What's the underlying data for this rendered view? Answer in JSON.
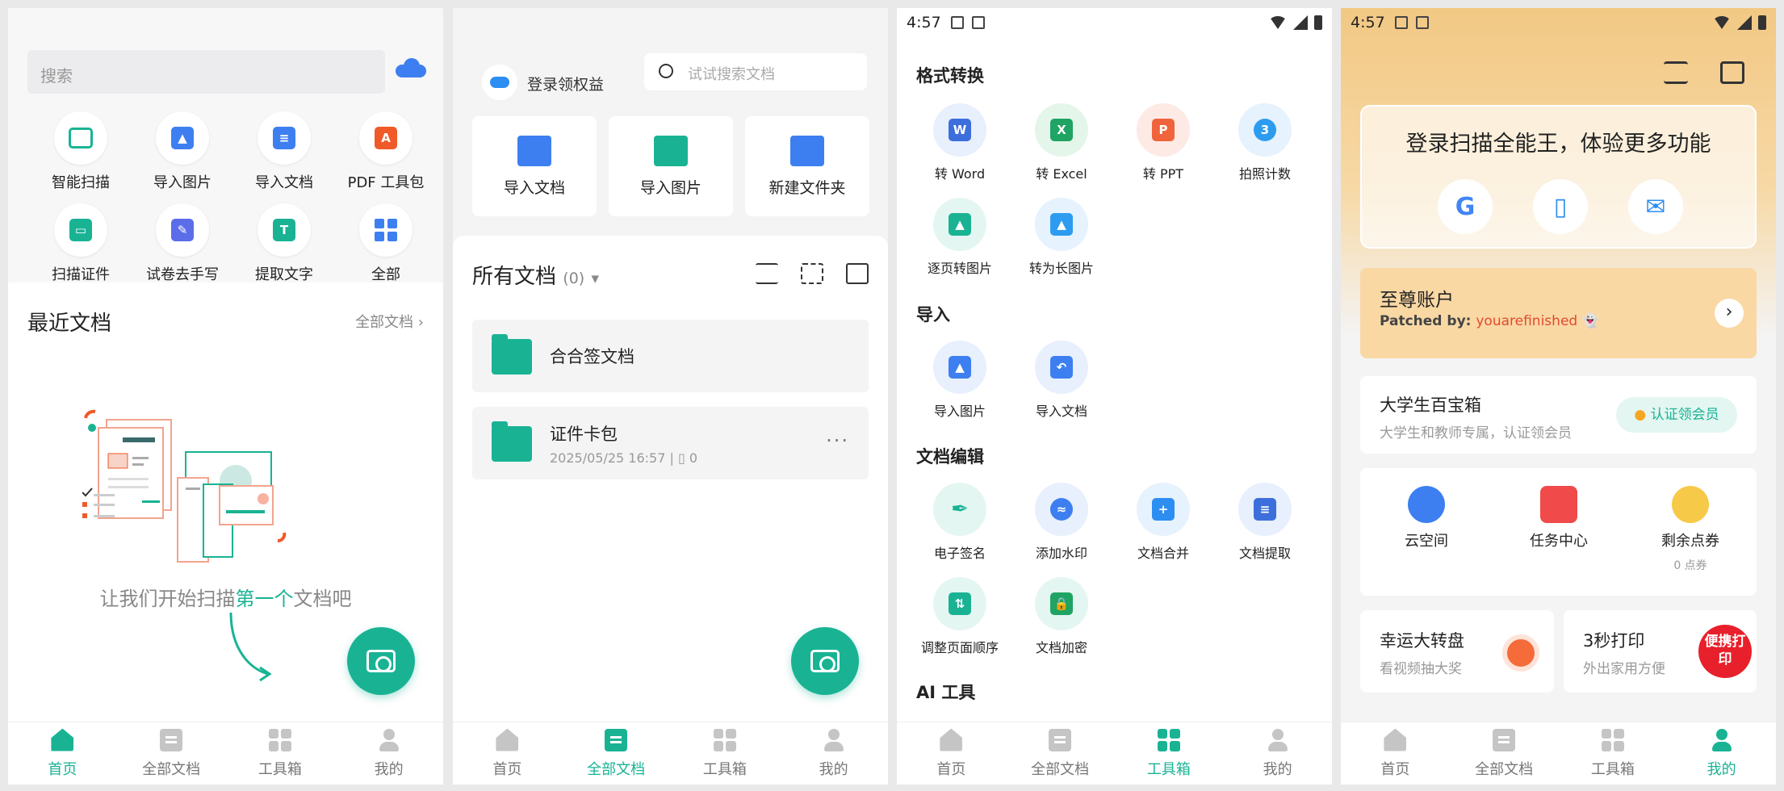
{
  "colors": {
    "accent": "#19b394",
    "vip_bg": "#f9d8a4"
  },
  "status": {
    "time": "4:57"
  },
  "nav": {
    "home": "首页",
    "all_docs": "全部文档",
    "toolbox": "工具箱",
    "me": "我的"
  },
  "home": {
    "search_placeholder": "搜索",
    "tools": [
      {
        "label": "智能扫描",
        "icon": "smart-scan-icon"
      },
      {
        "label": "导入图片",
        "icon": "import-image-icon"
      },
      {
        "label": "导入文档",
        "icon": "import-doc-icon"
      },
      {
        "label": "PDF 工具包",
        "icon": "pdf-toolkit-icon"
      },
      {
        "label": "扫描证件",
        "icon": "id-scan-icon"
      },
      {
        "label": "试卷去手写",
        "icon": "remove-handwriting-icon"
      },
      {
        "label": "提取文字",
        "icon": "extract-text-icon"
      },
      {
        "label": "全部",
        "icon": "all-tools-icon"
      }
    ],
    "recent_title": "最近文档",
    "recent_all": "全部文档",
    "empty_prefix": "让我们开始扫描",
    "empty_highlight": "第一个",
    "empty_suffix": "文档吧"
  },
  "docs": {
    "login_text": "登录领权益",
    "search_placeholder": "试试搜索文档",
    "quick": [
      {
        "label": "导入文档",
        "icon": "import-doc-icon"
      },
      {
        "label": "导入图片",
        "icon": "import-image-icon"
      },
      {
        "label": "新建文件夹",
        "icon": "new-folder-icon"
      }
    ],
    "title": "所有文档",
    "count": "(0)",
    "folders": [
      {
        "name": "合合签文档"
      },
      {
        "name": "证件卡包",
        "date": "2025/05/25 16:57",
        "files": "0"
      }
    ]
  },
  "toolbox": {
    "format_title": "格式转换",
    "format_tools": [
      {
        "label": "转 Word",
        "icon": "word-icon"
      },
      {
        "label": "转 Excel",
        "icon": "excel-icon"
      },
      {
        "label": "转 PPT",
        "icon": "ppt-icon"
      },
      {
        "label": "拍照计数",
        "icon": "photo-count-icon"
      },
      {
        "label": "逐页转图片",
        "icon": "page-to-image-icon"
      },
      {
        "label": "转为长图片",
        "icon": "long-image-icon"
      }
    ],
    "import_title": "导入",
    "import_tools": [
      {
        "label": "导入图片",
        "icon": "import-image-icon"
      },
      {
        "label": "导入文档",
        "icon": "import-doc-icon"
      }
    ],
    "edit_title": "文档编辑",
    "edit_tools": [
      {
        "label": "电子签名",
        "icon": "signature-icon"
      },
      {
        "label": "添加水印",
        "icon": "watermark-icon"
      },
      {
        "label": "文档合并",
        "icon": "merge-icon"
      },
      {
        "label": "文档提取",
        "icon": "extract-icon"
      },
      {
        "label": "调整页面顺序",
        "icon": "reorder-icon"
      },
      {
        "label": "文档加密",
        "icon": "encrypt-icon"
      }
    ],
    "ai_title": "AI 工具"
  },
  "profile": {
    "login_title": "登录扫描全能王，体验更多功能",
    "social": [
      "google-icon",
      "phone-icon",
      "email-icon"
    ],
    "vip_title": "至尊账户",
    "vip_patched_label": "Patched by:",
    "vip_patched_user": "youarefinished 👻",
    "uni_title": "大学生百宝箱",
    "uni_sub": "大学生和教师专属，认证领会员",
    "uni_btn": "认证领会员",
    "quick": [
      {
        "label": "云空间",
        "icon": "cloud-space-icon"
      },
      {
        "label": "任务中心",
        "icon": "task-center-icon"
      },
      {
        "label": "剩余点券",
        "icon": "coupon-icon",
        "sub": "0 点券"
      }
    ],
    "promo1_title": "幸运大转盘",
    "promo1_sub": "看视频抽大奖",
    "promo2_title": "3秒打印",
    "promo2_sub": "外出家用方便",
    "promo2_badge": "便携打印"
  }
}
